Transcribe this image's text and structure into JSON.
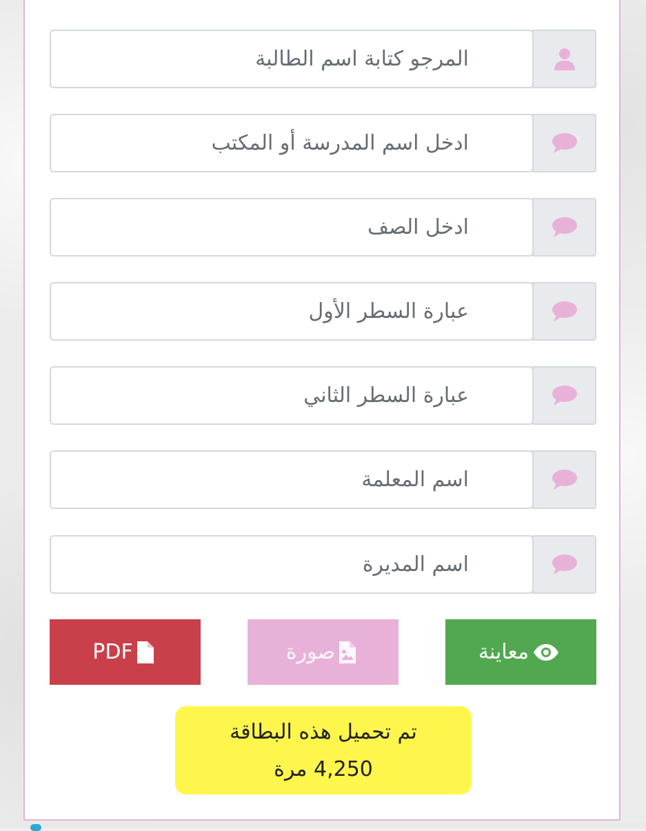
{
  "form": {
    "fields": [
      {
        "placeholder": "المرجو  كتابة اسم الطالبة",
        "icon": "user-icon"
      },
      {
        "placeholder": "ادخل اسم المدرسة أو المكتب",
        "icon": "comment-icon"
      },
      {
        "placeholder": "ادخل الصف",
        "icon": "comment-icon"
      },
      {
        "placeholder": "عبارة السطر الأول",
        "icon": "comment-icon"
      },
      {
        "placeholder": "عبارة السطر الثاني",
        "icon": "comment-icon"
      },
      {
        "placeholder": "اسم المعلمة",
        "icon": "comment-icon"
      },
      {
        "placeholder": "اسم المديرة",
        "icon": "comment-icon"
      }
    ]
  },
  "buttons": {
    "pdf": {
      "label": "PDF",
      "icon": "file-icon",
      "color": "#c9404a"
    },
    "image": {
      "label": "صورة",
      "icon": "image-file-icon",
      "color": "#e8b2d8"
    },
    "preview": {
      "label": "معاينة",
      "icon": "eye-icon",
      "color": "#52a850"
    }
  },
  "download_counter": {
    "line1": "تم تحميل هذه البطاقة",
    "count_text": "4,250 مرة",
    "background": "#fef64d"
  },
  "colors": {
    "panel_border": "#e2b4d6",
    "icon_pink": "#e8b2d8",
    "field_border": "#d5d8dc",
    "addon_background": "#e9eaed"
  }
}
